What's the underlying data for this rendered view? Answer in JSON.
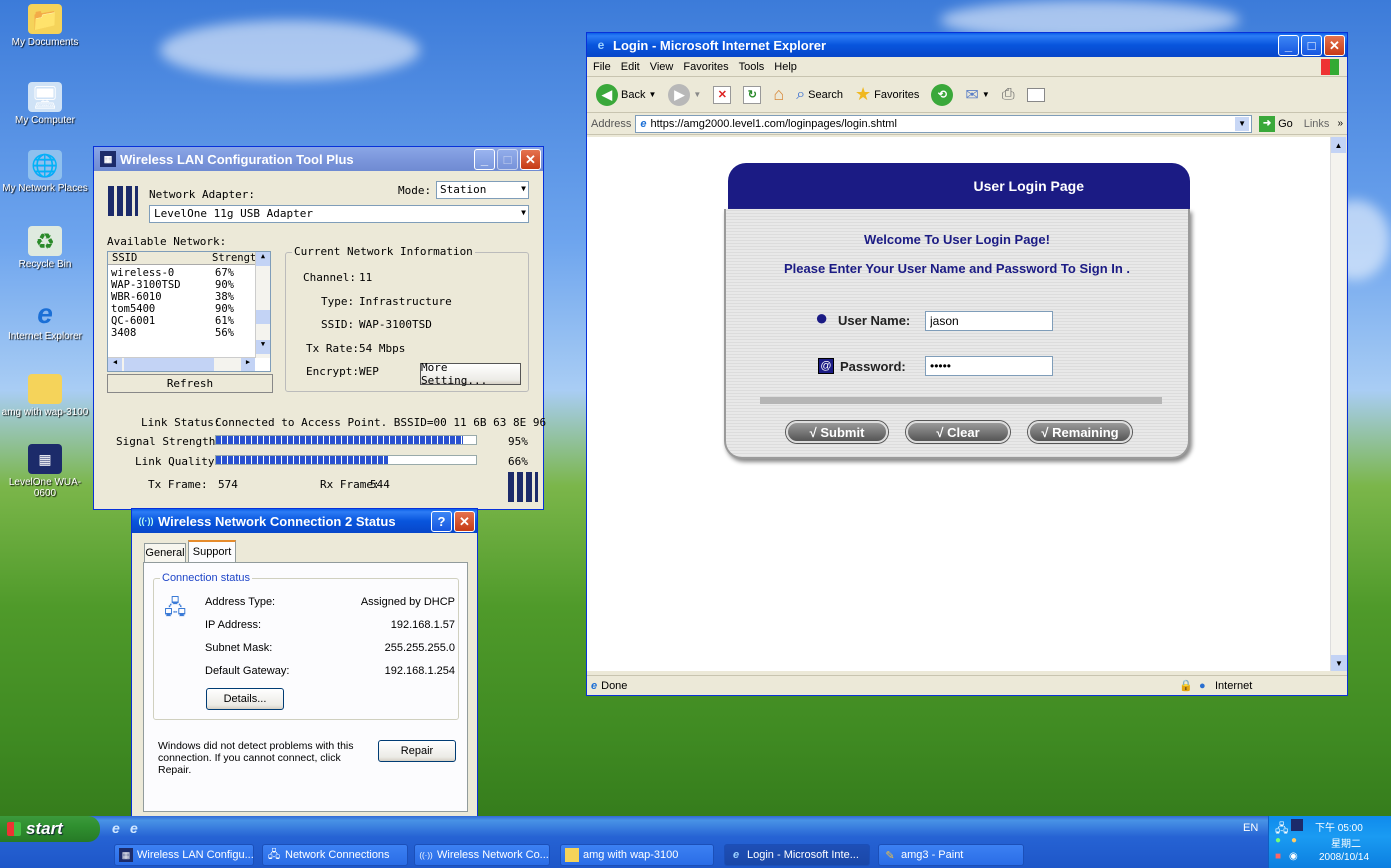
{
  "desktop": {
    "icons": [
      {
        "label": "My Documents",
        "icon": "folder-documents-icon"
      },
      {
        "label": "My Computer",
        "icon": "computer-icon"
      },
      {
        "label": "My Network Places",
        "icon": "network-places-icon"
      },
      {
        "label": "Recycle Bin",
        "icon": "recycle-bin-icon"
      },
      {
        "label": "Internet Explorer",
        "icon": "ie-icon"
      },
      {
        "label": "amg with wap-3100",
        "icon": "folder-icon"
      },
      {
        "label": "LevelOne WUA-0600",
        "icon": "levelone-icon"
      }
    ]
  },
  "ie": {
    "title": "Login - Microsoft Internet Explorer",
    "menu": [
      "File",
      "Edit",
      "View",
      "Favorites",
      "Tools",
      "Help"
    ],
    "toolbar": {
      "back": "Back",
      "search": "Search",
      "favorites": "Favorites"
    },
    "address_label": "Address",
    "url": "https://amg2000.level1.com/loginpages/login.shtml",
    "go": "Go",
    "links": "Links",
    "status": "Done",
    "zone": "Internet",
    "login": {
      "header": "User Login Page",
      "welcome": "Welcome To User Login Page!",
      "instructions": "Please Enter Your User Name and Password To Sign In .",
      "username_label": "User Name:",
      "username_value": "jason",
      "password_label": "Password:",
      "password_value": "•••••",
      "submit": "√  Submit",
      "clear": "√  Clear",
      "remaining": "√ Remaining"
    }
  },
  "wlan": {
    "title": "Wireless LAN Configuration Tool Plus",
    "adapter_label": "Network Adapter:",
    "mode_label": "Mode:",
    "mode_value": "Station",
    "adapter_value": "LevelOne 11g USB Adapter",
    "available_label": "Available Network:",
    "col_ssid": "SSID",
    "col_strength": "Strengt",
    "networks": [
      {
        "ssid": "wireless-0",
        "strength": "67%"
      },
      {
        "ssid": "WAP-3100TSD",
        "strength": "90%"
      },
      {
        "ssid": "WBR-6010",
        "strength": "38%"
      },
      {
        "ssid": "tom5400",
        "strength": "90%"
      },
      {
        "ssid": "QC-6001",
        "strength": "61%"
      },
      {
        "ssid": "3408",
        "strength": "56%"
      }
    ],
    "refresh": "Refresh",
    "current_info_label": "Current Network Information",
    "channel_label": "Channel:",
    "channel_value": "11",
    "type_label": "Type:",
    "type_value": "Infrastructure",
    "ssid_label": "SSID:",
    "ssid_value": "WAP-3100TSD",
    "txrate_label": "Tx Rate:",
    "txrate_value": "54 Mbps",
    "encrypt_label": "Encrypt:",
    "encrypt_value": "WEP",
    "more_setting": "More Setting...",
    "link_status_label": "Link Status:",
    "link_status_value": "Connected to Access Point. BSSID=00 11 6B 63 8E 96",
    "signal_label": "Signal Strength:",
    "signal_value": "95%",
    "signal_level": 0.95,
    "quality_label": "Link Quality:",
    "quality_value": "66%",
    "quality_level": 0.66,
    "tx_label": "Tx Frame:",
    "tx_value": "574",
    "rx_label": "Rx Frame:",
    "rx_value": "544"
  },
  "status": {
    "title": "Wireless Network Connection 2 Status",
    "tab_general": "General",
    "tab_support": "Support",
    "group_label": "Connection status",
    "address_type_label": "Address Type:",
    "address_type_value": "Assigned by DHCP",
    "ip_label": "IP Address:",
    "ip_value": "192.168.1.57",
    "mask_label": "Subnet Mask:",
    "mask_value": "255.255.255.0",
    "gateway_label": "Default Gateway:",
    "gateway_value": "192.168.1.254",
    "details": "Details...",
    "diag_text": "Windows did not detect problems with this connection. If you cannot connect, click Repair.",
    "repair": "Repair"
  },
  "taskbar": {
    "start": "start",
    "items": [
      {
        "label": "Wireless LAN Configu...",
        "icon": "levelone-icon"
      },
      {
        "label": "Network Connections",
        "icon": "network-connections-icon"
      },
      {
        "label": "Wireless Network Co...",
        "icon": "wireless-icon"
      },
      {
        "label": "amg with wap-3100",
        "icon": "folder-icon"
      },
      {
        "label": "Login - Microsoft Inte...",
        "icon": "ie-icon"
      },
      {
        "label": "amg3 - Paint",
        "icon": "paint-icon"
      }
    ],
    "lang": "EN",
    "time": "下午 05:00",
    "weekday": "星期二",
    "date": "2008/10/14"
  },
  "colors": {
    "xp_blue": "#0855dd",
    "login_header": "#1b1b84",
    "start_green": "#2f8f2f",
    "signal_bar": "#2a52d0"
  }
}
